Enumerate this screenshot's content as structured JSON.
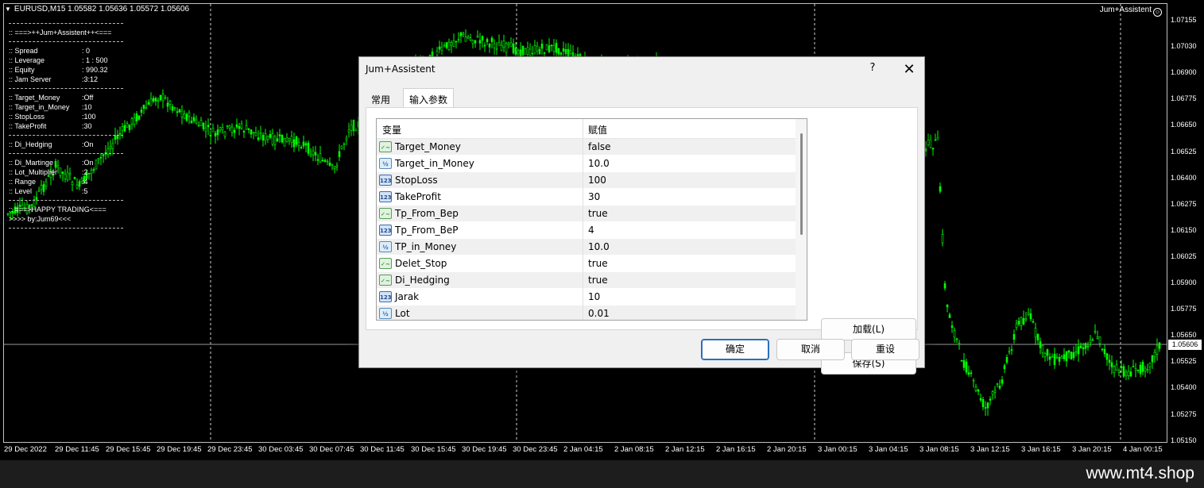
{
  "chart": {
    "header": "EURUSD,M15  1.05582 1.05636 1.05572 1.05606",
    "header_icon": "triangle-down-icon",
    "ea_name": "Jum+Assistent",
    "ea_icon": "smiley-icon",
    "current_price": "1.05606",
    "price_axis": [
      "1.07155",
      "1.07030",
      "1.06900",
      "1.06775",
      "1.06650",
      "1.06525",
      "1.06400",
      "1.06275",
      "1.06150",
      "1.06025",
      "1.05900",
      "1.05775",
      "1.05650",
      "1.05525",
      "1.05400",
      "1.05275",
      "1.05150"
    ],
    "time_axis": [
      "29 Dec 2022",
      "29 Dec 11:45",
      "29 Dec 15:45",
      "29 Dec 19:45",
      "29 Dec 23:45",
      "30 Dec 03:45",
      "30 Dec 07:45",
      "30 Dec 11:45",
      "30 Dec 15:45",
      "30 Dec 19:45",
      "30 Dec 23:45",
      "2 Jan 04:15",
      "2 Jan 08:15",
      "2 Jan 12:15",
      "2 Jan 16:15",
      "2 Jan 20:15",
      "3 Jan 00:15",
      "3 Jan 04:15",
      "3 Jan 08:15",
      "3 Jan 12:15",
      "3 Jan 16:15",
      "3 Jan 20:15",
      "4 Jan 00:15"
    ],
    "candle_color": "#00ff00",
    "background": "#000000"
  },
  "info_panel": {
    "title": ":: ===>++Jum+Assistent++<===",
    "account": [
      {
        "k": ":: Spread",
        "v": ": 0"
      },
      {
        "k": ":: Leverage",
        "v": ": 1 : 500"
      },
      {
        "k": ":: Equity",
        "v": ": 990.32"
      },
      {
        "k": ":: Jam Server",
        "v": ":3:12"
      }
    ],
    "targets": [
      {
        "k": ":: Target_Money",
        "v": ":Off"
      },
      {
        "k": ":: Target_in_Money",
        "v": ":10"
      },
      {
        "k": ":: StopLoss",
        "v": ":100"
      },
      {
        "k": ":: TakeProfit",
        "v": ":30"
      }
    ],
    "hedging": {
      "k": ":: Di_Hedging",
      "v": ":On"
    },
    "martingale": [
      {
        "k": ":: Di_Martinge",
        "v": ":On"
      },
      {
        "k": ":: Lot_Multiplier",
        "v": ":2"
      },
      {
        "k": ":: Range",
        "v": ":4"
      },
      {
        "k": ":: Level",
        "v": ":5"
      }
    ],
    "footer1": ":: ===>HAPPY TRADING<===",
    "footer2": ">>>> by:Jum69<<<"
  },
  "dialog": {
    "title": "Jum+Assistent",
    "help": "?",
    "close": "✕",
    "tabs": [
      "常用",
      "输入参数"
    ],
    "active_tab": "输入参数",
    "columns": [
      "变量",
      "赋值"
    ],
    "params": [
      {
        "name": "Target_Money",
        "value": "false",
        "type": "bool"
      },
      {
        "name": "Target_in_Money",
        "value": "10.0",
        "type": "double"
      },
      {
        "name": "StopLoss",
        "value": "100",
        "type": "int"
      },
      {
        "name": "TakeProfit",
        "value": "30",
        "type": "int"
      },
      {
        "name": "Tp_From_Bep",
        "value": "true",
        "type": "bool"
      },
      {
        "name": "Tp_From_BeP",
        "value": "4",
        "type": "int"
      },
      {
        "name": "TP_in_Money",
        "value": "10.0",
        "type": "double"
      },
      {
        "name": "Delet_Stop",
        "value": "true",
        "type": "bool"
      },
      {
        "name": "Di_Hedging",
        "value": "true",
        "type": "bool"
      },
      {
        "name": "Jarak",
        "value": "10",
        "type": "int"
      },
      {
        "name": "Lot",
        "value": "0.01",
        "type": "double"
      }
    ],
    "load_button": "加载(L)",
    "save_button": "保存(S)",
    "ok_button": "确定",
    "cancel_button": "取消",
    "reset_button": "重设"
  },
  "watermark": "www.mt4.shop"
}
